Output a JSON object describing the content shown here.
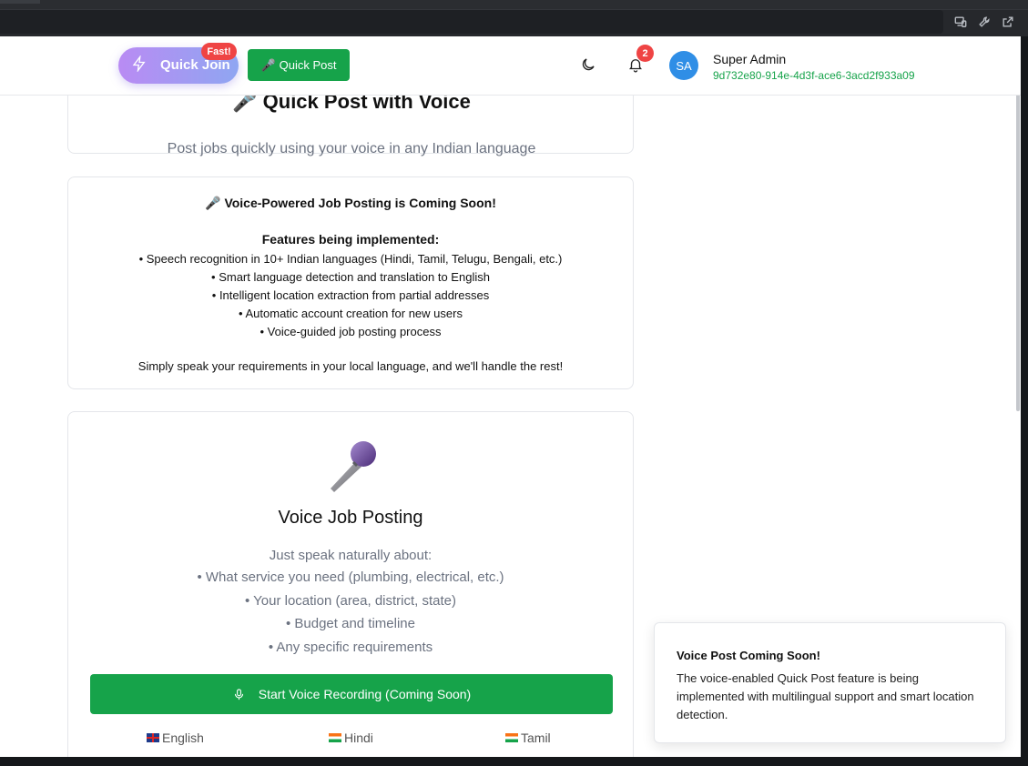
{
  "header": {
    "quick_join_label": "Quick Join",
    "fast_badge": "Fast!",
    "quick_post_label": "Quick Post",
    "notification_count": "2",
    "avatar_initials": "SA",
    "user_name": "Super Admin",
    "user_id": "9d732e80-914e-4d3f-ace6-3acd2f933a09"
  },
  "intro": {
    "title_partial": "🎤 Quick Post with Voice",
    "subtitle": "Post jobs quickly using your voice in any Indian language"
  },
  "coming_soon": {
    "title": "Voice-Powered Job Posting is Coming Soon!",
    "features_heading": "Features being implemented:",
    "features": [
      "• Speech recognition in 10+ Indian languages (Hindi, Tamil, Telugu, Bengali, etc.)",
      "• Smart language detection and translation to English",
      "• Intelligent location extraction from partial addresses",
      "• Automatic account creation for new users",
      "• Voice-guided job posting process"
    ],
    "footer": "Simply speak your requirements in your local language, and we'll handle the rest!"
  },
  "voice_card": {
    "title": "Voice Job Posting",
    "speak_heading": "Just speak naturally about:",
    "speak_items": [
      "• What service you need (plumbing, electrical, etc.)",
      "• Your location (area, district, state)",
      "• Budget and timeline",
      "• Any specific requirements"
    ],
    "record_button": "Start Voice Recording (Coming Soon)",
    "languages": [
      "English",
      "Hindi",
      "Tamil"
    ]
  },
  "toast": {
    "title": "Voice Post Coming Soon!",
    "body": "The voice-enabled Quick Post feature is being implemented with multilingual support and smart location detection."
  },
  "colors": {
    "primary_green": "#16a34a",
    "badge_red": "#ef4444",
    "avatar_blue": "#2f8ee6"
  },
  "icons": [
    "bolt-icon",
    "microphone-icon",
    "moon-icon",
    "bell-icon",
    "devices-icon",
    "wrench-icon",
    "external-link-icon"
  ]
}
